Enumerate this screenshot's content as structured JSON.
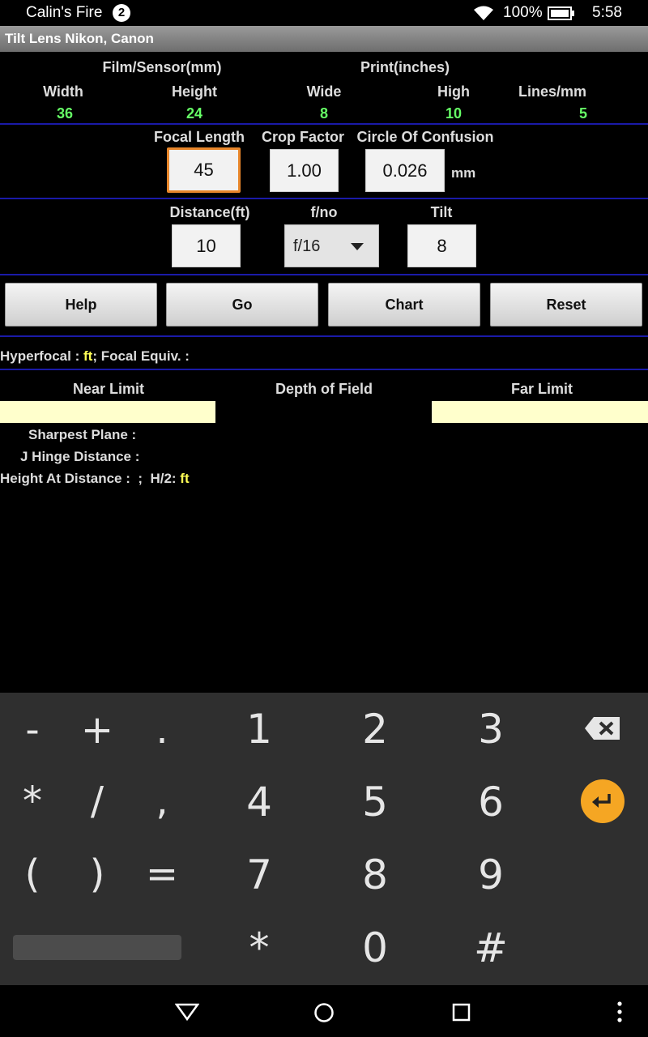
{
  "status_bar": {
    "device_name": "Calin's Fire",
    "notification_count": "2",
    "battery_percent": "100%",
    "time": "5:58"
  },
  "app_title": "Tilt Lens Nikon, Canon",
  "film": {
    "section_label": "Film/Sensor(mm)",
    "width_label": "Width",
    "width_value": "36",
    "height_label": "Height",
    "height_value": "24"
  },
  "print": {
    "section_label": "Print(inches)",
    "wide_label": "Wide",
    "wide_value": "8",
    "high_label": "High",
    "high_value": "10",
    "lines_label": "Lines/mm",
    "lines_value": "5"
  },
  "lens": {
    "focal_length_label": "Focal Length",
    "focal_length_value": "45",
    "crop_factor_label": "Crop Factor",
    "crop_factor_value": "1.00",
    "coc_label": "Circle Of Confusion",
    "coc_value": "0.026",
    "coc_unit": "mm"
  },
  "settings": {
    "distance_label": "Distance(ft)",
    "distance_value": "10",
    "fno_label": "f/no",
    "fno_selected": "f/16",
    "tilt_label": "Tilt",
    "tilt_value": "8"
  },
  "buttons": {
    "help": "Help",
    "go": "Go",
    "chart": "Chart",
    "reset": "Reset"
  },
  "results": {
    "hyperfocal_prefix": "Hyperfocal : ",
    "hyperfocal_unit": "ft",
    "focal_equiv": "; Focal Equiv. :",
    "near_limit_label": "Near Limit",
    "dof_label": "Depth of Field",
    "far_limit_label": "Far Limit",
    "sharpest_plane": "Sharpest Plane :",
    "j_hinge": "J Hinge Distance :",
    "height_at_distance": "Height At Distance :  ;  H/2: ",
    "h2_unit": "ft"
  },
  "keyboard": {
    "row1": [
      "-",
      "+",
      ".",
      "1",
      "2",
      "3"
    ],
    "row2": [
      "*",
      "/",
      ",",
      "4",
      "5",
      "6"
    ],
    "row3": [
      "(",
      ")",
      "=",
      "7",
      "8",
      "9"
    ],
    "row4": [
      "*",
      "0",
      "#"
    ],
    "backspace_icon": "backspace-icon",
    "enter_icon": "enter-icon",
    "enter_color": "#f5a623"
  },
  "colors": {
    "value_green": "#66ff66",
    "accent_yellow": "#ffff55",
    "divider_blue": "#1a1aa8",
    "result_box": "#ffffcc"
  }
}
